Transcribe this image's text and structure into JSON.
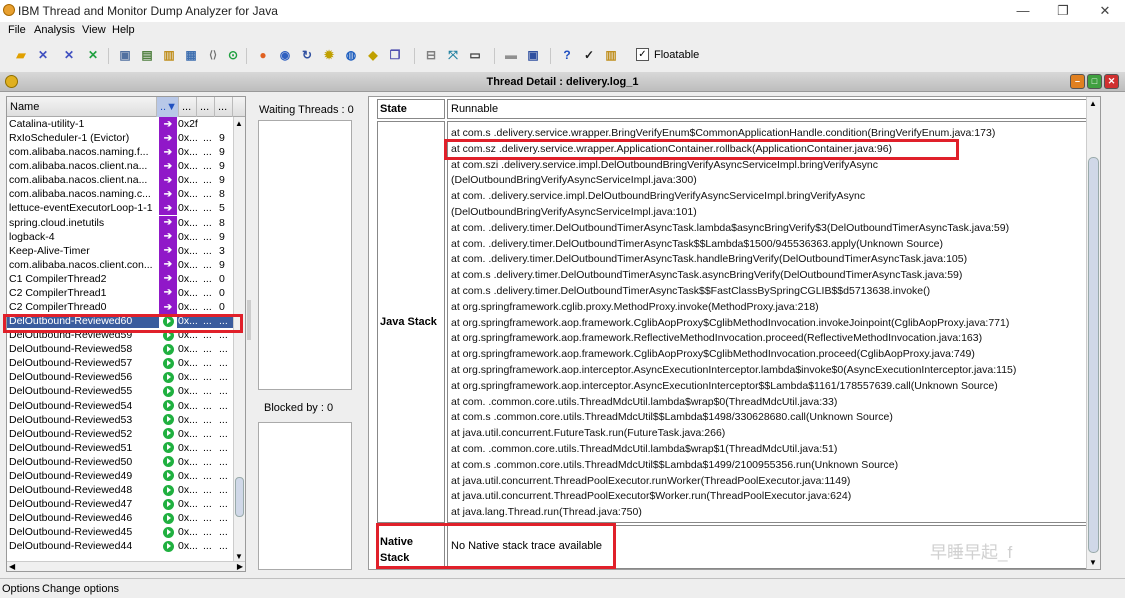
{
  "window": {
    "title": "IBM Thread and Monitor Dump Analyzer for Java",
    "minimize": "—",
    "maximize": "❐",
    "close": "✕"
  },
  "menu": [
    "File",
    "Analysis",
    "View",
    "Help"
  ],
  "toolbar": {
    "floatable_label": "Floatable",
    "floatable_checked": "✓"
  },
  "frame": {
    "title": "Thread Detail : delivery.log_1"
  },
  "thread_list": {
    "columns": [
      "Name",
      "..▼",
      "...",
      "...",
      "..."
    ],
    "rows": [
      {
        "name": "Catalina-utility-1",
        "state": "wait",
        "c1": "0x2f",
        "c2": "",
        "c3": ""
      },
      {
        "name": "RxIoScheduler-1 (Evictor)",
        "state": "wait",
        "c1": "0x...",
        "c2": "...",
        "c3": "9"
      },
      {
        "name": "com.alibaba.nacos.naming.f...",
        "state": "wait",
        "c1": "0x...",
        "c2": "...",
        "c3": "9"
      },
      {
        "name": "com.alibaba.nacos.client.na...",
        "state": "wait",
        "c1": "0x...",
        "c2": "...",
        "c3": "9"
      },
      {
        "name": "com.alibaba.nacos.client.na...",
        "state": "wait",
        "c1": "0x...",
        "c2": "...",
        "c3": "9"
      },
      {
        "name": "com.alibaba.nacos.naming.c...",
        "state": "wait",
        "c1": "0x...",
        "c2": "...",
        "c3": "8"
      },
      {
        "name": "lettuce-eventExecutorLoop-1-1",
        "state": "wait",
        "c1": "0x...",
        "c2": "...",
        "c3": "5"
      },
      {
        "name": "spring.cloud.inetutils",
        "state": "wait",
        "c1": "0x...",
        "c2": "...",
        "c3": "8"
      },
      {
        "name": "logback-4",
        "state": "wait",
        "c1": "0x...",
        "c2": "...",
        "c3": "9"
      },
      {
        "name": "Keep-Alive-Timer",
        "state": "wait",
        "c1": "0x...",
        "c2": "...",
        "c3": "3"
      },
      {
        "name": "com.alibaba.nacos.client.con...",
        "state": "wait",
        "c1": "0x...",
        "c2": "...",
        "c3": "9"
      },
      {
        "name": "C1 CompilerThread2",
        "state": "wait",
        "c1": "0x...",
        "c2": "...",
        "c3": "0"
      },
      {
        "name": "C2 CompilerThread1",
        "state": "wait",
        "c1": "0x...",
        "c2": "...",
        "c3": "0"
      },
      {
        "name": "C2 CompilerThread0",
        "state": "wait",
        "c1": "0x...",
        "c2": "...",
        "c3": "0"
      },
      {
        "name": "DelOutbound-Reviewed60",
        "state": "run",
        "c1": "0x...",
        "c2": "...",
        "c3": "...",
        "selected": true
      },
      {
        "name": "DelOutbound-Reviewed59",
        "state": "run",
        "c1": "0x...",
        "c2": "...",
        "c3": "..."
      },
      {
        "name": "DelOutbound-Reviewed58",
        "state": "run",
        "c1": "0x...",
        "c2": "...",
        "c3": "..."
      },
      {
        "name": "DelOutbound-Reviewed57",
        "state": "run",
        "c1": "0x...",
        "c2": "...",
        "c3": "..."
      },
      {
        "name": "DelOutbound-Reviewed56",
        "state": "run",
        "c1": "0x...",
        "c2": "...",
        "c3": "..."
      },
      {
        "name": "DelOutbound-Reviewed55",
        "state": "run",
        "c1": "0x...",
        "c2": "...",
        "c3": "..."
      },
      {
        "name": "DelOutbound-Reviewed54",
        "state": "run",
        "c1": "0x...",
        "c2": "...",
        "c3": "..."
      },
      {
        "name": "DelOutbound-Reviewed53",
        "state": "run",
        "c1": "0x...",
        "c2": "...",
        "c3": "..."
      },
      {
        "name": "DelOutbound-Reviewed52",
        "state": "run",
        "c1": "0x...",
        "c2": "...",
        "c3": "..."
      },
      {
        "name": "DelOutbound-Reviewed51",
        "state": "run",
        "c1": "0x...",
        "c2": "...",
        "c3": "..."
      },
      {
        "name": "DelOutbound-Reviewed50",
        "state": "run",
        "c1": "0x...",
        "c2": "...",
        "c3": "..."
      },
      {
        "name": "DelOutbound-Reviewed49",
        "state": "run",
        "c1": "0x...",
        "c2": "...",
        "c3": "..."
      },
      {
        "name": "DelOutbound-Reviewed48",
        "state": "run",
        "c1": "0x...",
        "c2": "...",
        "c3": "..."
      },
      {
        "name": "DelOutbound-Reviewed47",
        "state": "run",
        "c1": "0x...",
        "c2": "...",
        "c3": "..."
      },
      {
        "name": "DelOutbound-Reviewed46",
        "state": "run",
        "c1": "0x...",
        "c2": "...",
        "c3": "..."
      },
      {
        "name": "DelOutbound-Reviewed45",
        "state": "run",
        "c1": "0x...",
        "c2": "...",
        "c3": "..."
      },
      {
        "name": "DelOutbound-Reviewed44",
        "state": "run",
        "c1": "0x...",
        "c2": "...",
        "c3": "..."
      }
    ]
  },
  "waiting": {
    "label": "Waiting Threads : 0"
  },
  "blocked": {
    "label": "Blocked by : 0"
  },
  "detail": {
    "state_label": "State",
    "state_value": "Runnable",
    "java_stack_label": "Java Stack",
    "java_stack": [
      "at com.s      .delivery.service.wrapper.BringVerifyEnum$CommonApplicationHandle.condition(BringVerifyEnum.java:173)",
      "at com.sz      .delivery.service.wrapper.ApplicationContainer.rollback(ApplicationContainer.java:96)",
      "at com.szi      .delivery.service.impl.DelOutboundBringVerifyAsyncServiceImpl.bringVerifyAsync",
      "(DelOutboundBringVerifyAsyncServiceImpl.java:300)",
      "at com.      .delivery.service.impl.DelOutboundBringVerifyAsyncServiceImpl.bringVerifyAsync",
      "(DelOutboundBringVerifyAsyncServiceImpl.java:101)",
      "at com.      .delivery.timer.DelOutboundTimerAsyncTask.lambda$asyncBringVerify$3(DelOutboundTimerAsyncTask.java:59)",
      "at com.      .delivery.timer.DelOutboundTimerAsyncTask$$Lambda$1500/945536363.apply(Unknown Source)",
      "at com.      .delivery.timer.DelOutboundTimerAsyncTask.handleBringVerify(DelOutboundTimerAsyncTask.java:105)",
      "at com.s      .delivery.timer.DelOutboundTimerAsyncTask.asyncBringVerify(DelOutboundTimerAsyncTask.java:59)",
      "at com.s      .delivery.timer.DelOutboundTimerAsyncTask$$FastClassBySpringCGLIB$$d5713638.invoke()",
      "at org.springframework.cglib.proxy.MethodProxy.invoke(MethodProxy.java:218)",
      "at org.springframework.aop.framework.CglibAopProxy$CglibMethodInvocation.invokeJoinpoint(CglibAopProxy.java:771)",
      "at org.springframework.aop.framework.ReflectiveMethodInvocation.proceed(ReflectiveMethodInvocation.java:163)",
      "at org.springframework.aop.framework.CglibAopProxy$CglibMethodInvocation.proceed(CglibAopProxy.java:749)",
      "at org.springframework.aop.interceptor.AsyncExecutionInterceptor.lambda$invoke$0(AsyncExecutionInterceptor.java:115)",
      "at org.springframework.aop.interceptor.AsyncExecutionInterceptor$$Lambda$1161/178557639.call(Unknown Source)",
      "at com.      .common.core.utils.ThreadMdcUtil.lambda$wrap$0(ThreadMdcUtil.java:33)",
      "at com.s      .common.core.utils.ThreadMdcUtil$$Lambda$1498/330628680.call(Unknown Source)",
      "at java.util.concurrent.FutureTask.run(FutureTask.java:266)",
      "at com.      .common.core.utils.ThreadMdcUtil.lambda$wrap$1(ThreadMdcUtil.java:51)",
      "at com.s      .common.core.utils.ThreadMdcUtil$$Lambda$1499/2100955356.run(Unknown Source)",
      "at java.util.concurrent.ThreadPoolExecutor.runWorker(ThreadPoolExecutor.java:1149)",
      "at java.util.concurrent.ThreadPoolExecutor$Worker.run(ThreadPoolExecutor.java:624)",
      "at java.lang.Thread.run(Thread.java:750)"
    ],
    "native_label": "Native Stack",
    "native_value": "No Native stack trace available"
  },
  "watermark": "早睡早起_f",
  "status": {
    "options": "Options",
    "change": "Change options"
  },
  "colors": {
    "highlight": "#e0202a",
    "waiting": "#9018c8",
    "selected": "#3a5c9e",
    "running": "#20b040"
  }
}
